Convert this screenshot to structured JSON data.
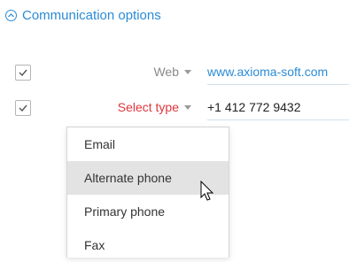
{
  "section": {
    "title": "Communication options",
    "icon": "chevron-up-circle-icon",
    "accent_color": "#2b8bd6"
  },
  "rows": [
    {
      "checked": true,
      "type_label": "Web",
      "type_color": "#8a8a8a",
      "value": "www.axioma-soft.com",
      "value_color": "#2b8bd6"
    },
    {
      "checked": true,
      "type_label": "Select type",
      "type_color": "#e0363d",
      "value": "+1 412 772 9432",
      "value_color": "#222222"
    }
  ],
  "dropdown": {
    "options": [
      {
        "label": "Email",
        "hovered": false
      },
      {
        "label": "Alternate phone",
        "hovered": true
      },
      {
        "label": "Primary phone",
        "hovered": false
      },
      {
        "label": "Fax",
        "hovered": false
      }
    ]
  }
}
